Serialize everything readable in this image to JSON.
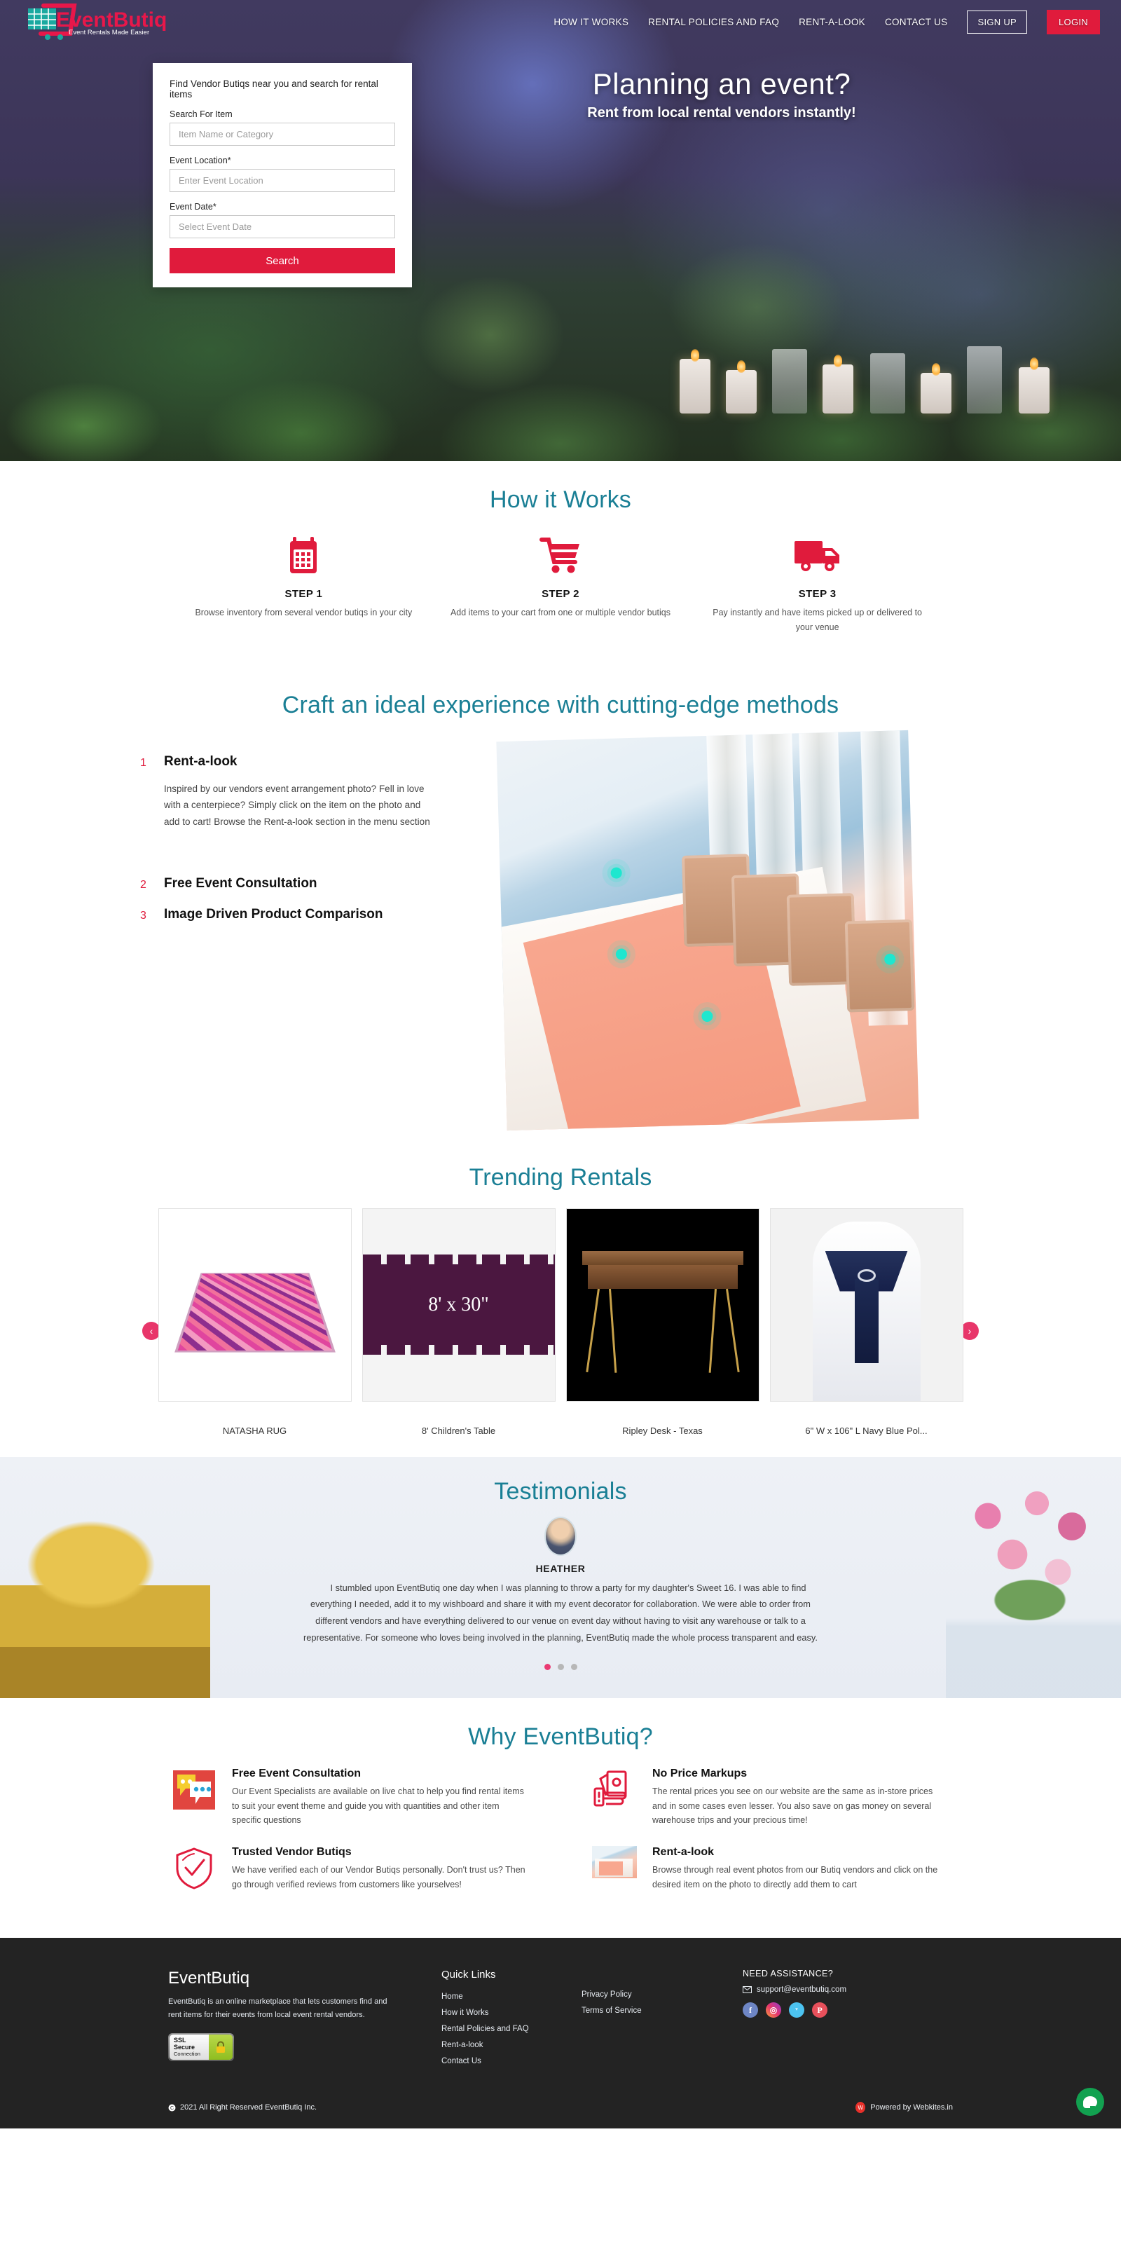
{
  "brand": {
    "name": "EventButiq",
    "tagline": "Event Rentals Made Easier"
  },
  "nav": {
    "links": [
      {
        "label": "HOW IT WORKS"
      },
      {
        "label": "RENTAL POLICIES AND FAQ"
      },
      {
        "label": "RENT-A-LOOK"
      },
      {
        "label": "CONTACT US"
      }
    ],
    "signup_label": "SIGN UP",
    "login_label": "LOGIN"
  },
  "hero": {
    "headline": "Planning an event?",
    "subheadline": "Rent from local rental vendors instantly!"
  },
  "search_card": {
    "title": "Find Vendor Butiqs near you and search for rental items",
    "item_label": "Search For Item",
    "item_placeholder": "Item Name or Category",
    "item_value": "",
    "location_label": "Event Location*",
    "location_placeholder": "Enter Event Location",
    "location_value": "",
    "date_label": "Event Date*",
    "date_placeholder": "Select Event Date",
    "date_value": "",
    "button_label": "Search"
  },
  "how_it_works": {
    "title": "How it Works",
    "steps": [
      {
        "icon": "calendar-icon",
        "name": "STEP 1",
        "desc": "Browse inventory from several vendor butiqs in your city"
      },
      {
        "icon": "cart-icon",
        "name": "STEP 2",
        "desc": "Add items to your cart from one or multiple vendor butiqs"
      },
      {
        "icon": "truck-icon",
        "name": "STEP 3",
        "desc": "Pay instantly and have items picked up or delivered to your venue"
      }
    ]
  },
  "craft": {
    "title": "Craft an ideal experience with cutting-edge methods",
    "items": [
      {
        "num": "1",
        "head": "Rent-a-look",
        "body": "Inspired by our vendors event arrangement photo? Fell in love with a centerpiece? Simply click on the item on the photo and add to cart! Browse the Rent-a-look section in the menu section"
      },
      {
        "num": "2",
        "head": "Free Event Consultation",
        "body": ""
      },
      {
        "num": "3",
        "head": "Image Driven Product Comparison",
        "body": ""
      }
    ]
  },
  "trending": {
    "title": "Trending Rentals",
    "prev_label": "‹",
    "next_label": "›",
    "products": [
      {
        "name": "NATASHA RUG",
        "art": "rug"
      },
      {
        "name": "8' Children's Table",
        "art": "table",
        "caption": "8' x 30\""
      },
      {
        "name": "Ripley Desk - Texas",
        "art": "desk"
      },
      {
        "name": "6\" W x 106\" L Navy Blue Pol...",
        "art": "chair"
      }
    ]
  },
  "testimonials": {
    "title": "Testimonials",
    "name": "HEATHER",
    "quote": "I stumbled upon EventButiq one day when I was planning to throw a party for my daughter's Sweet 16. I was able to find everything I needed, add it to my wishboard and share it with my event decorator for collaboration. We were able to order from different vendors and have everything delivered to our venue on event day without having to visit any warehouse or talk to a representative. For someone who loves being involved in the planning, EventButiq made the whole process transparent and easy.",
    "active_dot": 0,
    "dot_count": 3
  },
  "why": {
    "title": "Why EventButiq?",
    "items": [
      {
        "icon": "chat-bubbles-icon",
        "title": "Free Event Consultation",
        "desc": "Our Event Specialists are available on live chat to help you find rental items to suit your event theme and guide you with quantities and other item specific questions"
      },
      {
        "icon": "money-hand-icon",
        "title": "No Price Markups",
        "desc": "The rental prices you see on our website are the same as in-store prices and in some cases even lesser. You also save on gas money on several warehouse trips and your precious time!"
      },
      {
        "icon": "shield-check-icon",
        "title": "Trusted Vendor Butiqs",
        "desc": "We have verified each of our Vendor Butiqs personally. Don't trust us? Then go through verified reviews from customers like yourselves!"
      },
      {
        "icon": "event-photo-icon",
        "title": "Rent-a-look",
        "desc": "Browse through real event photos from our Butiq vendors and click on the desired item on the photo to directly add them to cart"
      }
    ]
  },
  "footer": {
    "brand": "EventButiq",
    "about": "EventButiq is an online marketplace that lets customers find and rent items for their events from local event rental vendors.",
    "ssl_line1": "SSL",
    "ssl_line2": "Secure",
    "ssl_line3": "Connection",
    "quick_links_head": "Quick Links",
    "quick_links": [
      {
        "label": "Home"
      },
      {
        "label": "How it Works"
      },
      {
        "label": "Rental Policies and FAQ"
      },
      {
        "label": "Rent-a-look"
      },
      {
        "label": "Contact Us"
      }
    ],
    "legal_links": [
      {
        "label": "Privacy Policy"
      },
      {
        "label": "Terms of Service"
      }
    ],
    "assistance_head": "NEED ASSISTANCE?",
    "email": "support@eventbutiq.com",
    "socials": [
      {
        "name": "facebook-icon",
        "glyph": "f"
      },
      {
        "name": "instagram-icon",
        "glyph": "◎"
      },
      {
        "name": "twitter-icon",
        "glyph": "ᵛ"
      },
      {
        "name": "pinterest-icon",
        "glyph": "P"
      }
    ],
    "copyright": "2021 All Right Reserved EventButiq Inc.",
    "powered_by": "Powered by Webkites.in",
    "powered_mark": "W"
  },
  "colors": {
    "accent_red": "#e01b3c",
    "teal_heading": "#1a7f95",
    "pink_dot": "#ea3b73",
    "marker_teal": "#1ee7cf",
    "footer_bg": "#232323",
    "chat_green": "#12a150"
  }
}
